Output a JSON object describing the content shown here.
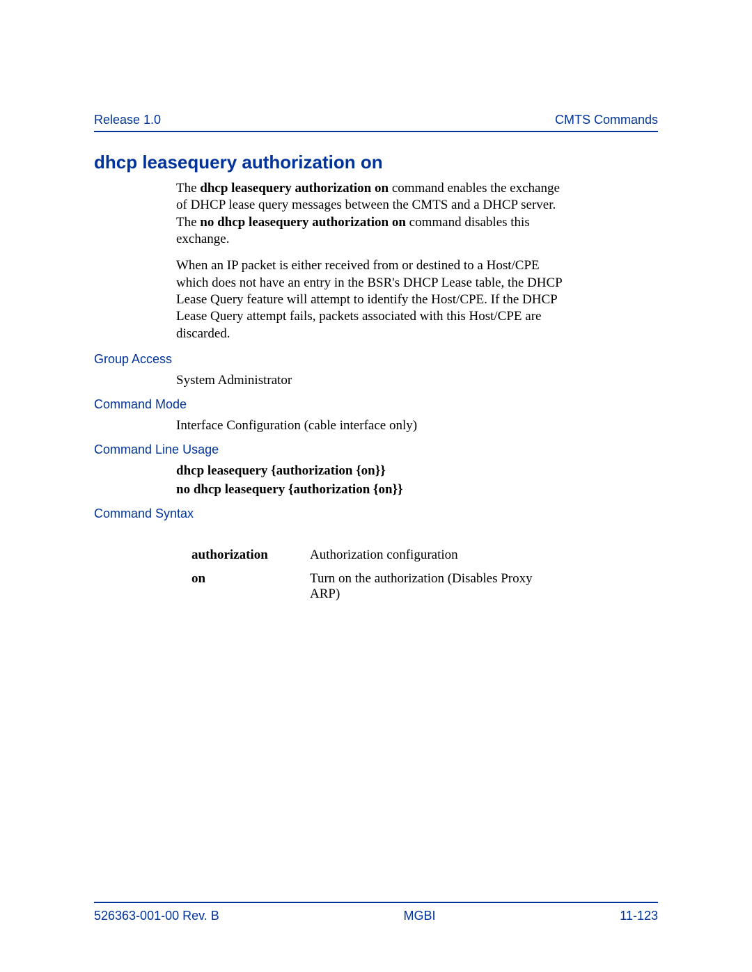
{
  "header": {
    "left": "Release 1.0",
    "right": "CMTS Commands"
  },
  "title": "dhcp leasequery authorization on",
  "intro": {
    "p1_pre": "The ",
    "p1_b1": "dhcp leasequery authorization on",
    "p1_mid": " command enables the exchange of DHCP lease query messages between the CMTS and a DHCP server. The ",
    "p1_b2": "no dhcp leasequery authorization on",
    "p1_post": " command disables this exchange.",
    "p2": "When an IP packet is either received from or destined to a Host/CPE which does not have an entry in the BSR's DHCP Lease table, the DHCP Lease Query feature will attempt to identify the Host/CPE. If the DHCP Lease Query attempt fails, packets associated with this Host/CPE are discarded."
  },
  "sections": {
    "group_access_label": "Group Access",
    "group_access_value": "System Administrator",
    "command_mode_label": "Command Mode",
    "command_mode_value": "Interface Configuration (cable interface only)",
    "command_line_usage_label": "Command Line Usage",
    "usage_line1": "dhcp leasequery {authorization {on}}",
    "usage_line2": "no dhcp leasequery {authorization {on}}",
    "command_syntax_label": "Command Syntax"
  },
  "params": [
    {
      "name": "authorization",
      "desc": "Authorization configuration"
    },
    {
      "name": "on",
      "desc": "Turn on the authorization (Disables Proxy ARP)"
    }
  ],
  "footer": {
    "left": "526363-001-00 Rev. B",
    "center": "MGBI",
    "right": "11-123"
  }
}
